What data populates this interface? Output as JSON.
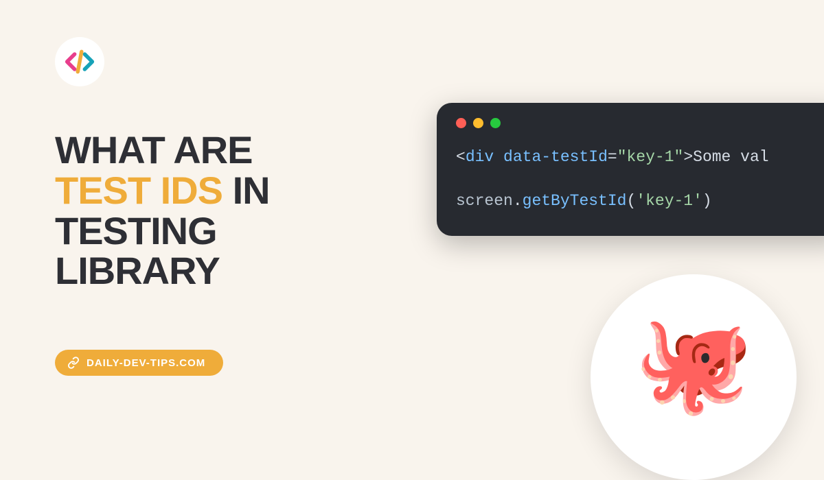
{
  "headline": {
    "line1": "WHAT ARE",
    "highlight": "TEST IDS",
    "line2_suffix": " IN",
    "line3": "TESTING",
    "line4": "LIBRARY"
  },
  "site_pill": {
    "label": "DAILY-DEV-TIPS.COM"
  },
  "code": {
    "line1": {
      "open_bracket": "<",
      "tag": "div",
      "space": " ",
      "attr": "data-testId",
      "eq": "=",
      "q1": "\"",
      "str": "key-1",
      "q2": "\"",
      "close_bracket": ">",
      "text": "Some val"
    },
    "line2": {
      "obj": "screen",
      "dot": ".",
      "method": "getByTestId",
      "paren_open": "(",
      "q1": "'",
      "str": "key-1",
      "q2": "'",
      "paren_close": ")"
    }
  },
  "mascot": {
    "emoji": "🐙"
  }
}
